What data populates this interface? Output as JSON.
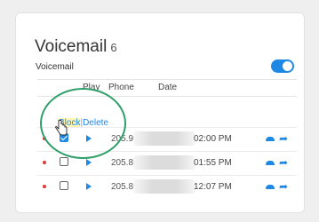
{
  "header": {
    "title": "Voicemail",
    "count": "6"
  },
  "settings": {
    "voicemail_label": "Voicemail",
    "toggle_on": true
  },
  "columns": [
    "Play",
    "Phone",
    "Date"
  ],
  "actions": {
    "block_label": "Block",
    "separator": "|",
    "delete_label": "Delete"
  },
  "rows": [
    {
      "unread": true,
      "checked": true,
      "phone": "205.9",
      "time": "02:00 PM"
    },
    {
      "unread": true,
      "checked": false,
      "phone": "205.8",
      "time": "01:55 PM"
    },
    {
      "unread": true,
      "checked": false,
      "phone": "205.8",
      "time": "12:07 PM"
    }
  ],
  "colors": {
    "accent": "#1e88e5",
    "unread_dot": "#e53935",
    "highlight": "#2e9e6a"
  }
}
